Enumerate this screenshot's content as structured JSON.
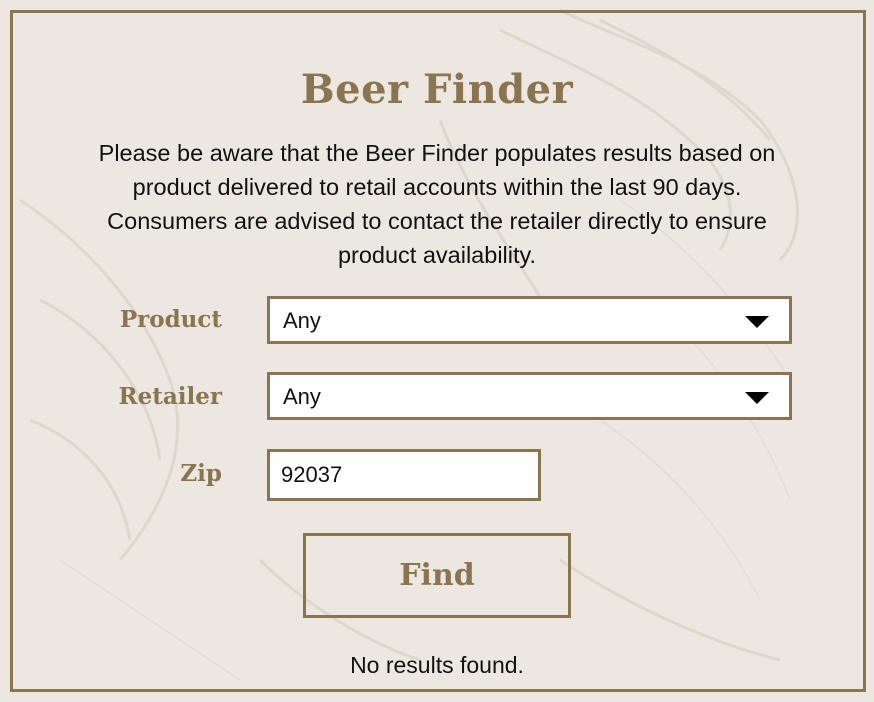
{
  "page": {
    "title": "Beer Finder",
    "notice": "Please be aware that the Beer Finder populates results based on product delivered to retail accounts within the last 90 days. Consumers are advised to contact the retailer directly to ensure product availability."
  },
  "form": {
    "product": {
      "label": "Product",
      "value": "Any"
    },
    "retailer": {
      "label": "Retailer",
      "value": "Any"
    },
    "zip": {
      "label": "Zip",
      "value": "92037"
    },
    "find_label": "Find"
  },
  "results": {
    "message": "No results found."
  },
  "colors": {
    "accent": "#8b7550",
    "background": "#ece8e1",
    "text": "#111111"
  },
  "icons": {
    "dropdown": "caret-down-icon"
  }
}
